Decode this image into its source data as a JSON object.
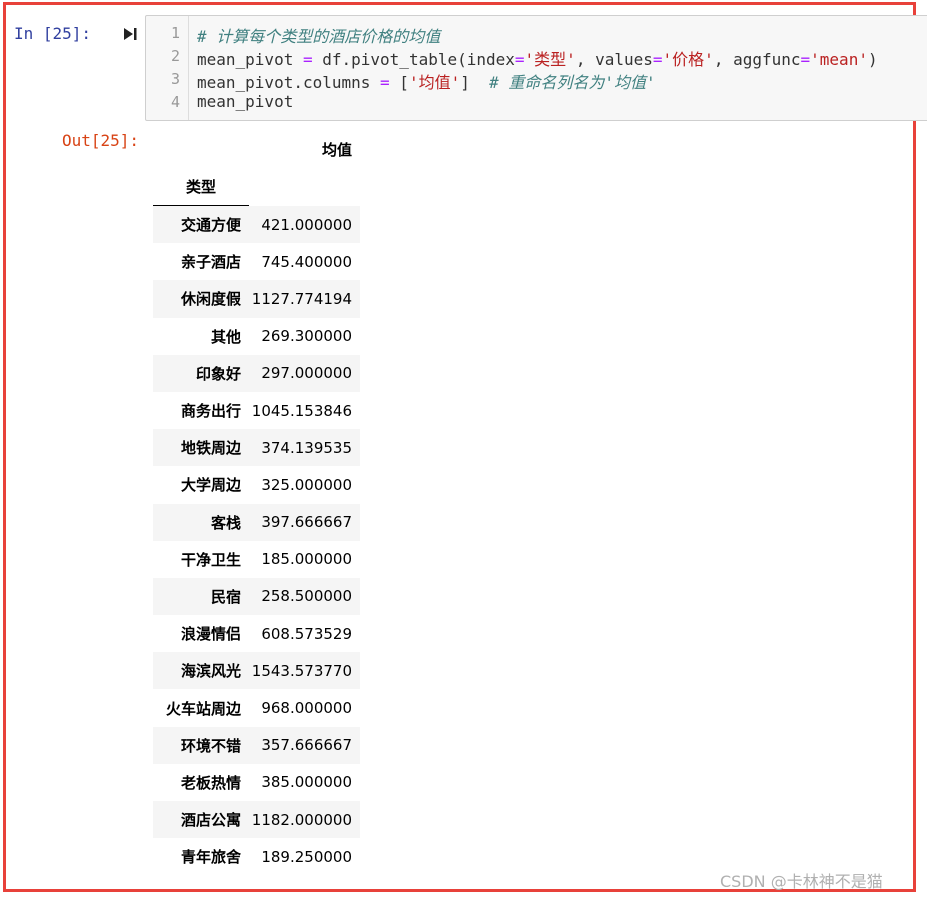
{
  "input_prompt": "In  [25]:",
  "output_prompt": "Out[25]:",
  "icons": {
    "run": "run-cell-icon"
  },
  "code": {
    "line_numbers": [
      "1",
      "2",
      "3",
      "4"
    ],
    "lines": [
      [
        {
          "text": "# 计算每个类型的酒店价格的均值",
          "kind": "comment"
        }
      ],
      [
        {
          "text": "mean_pivot ",
          "kind": "plain"
        },
        {
          "text": "=",
          "kind": "op"
        },
        {
          "text": " df.pivot_table(index",
          "kind": "plain"
        },
        {
          "text": "=",
          "kind": "op"
        },
        {
          "text": "'类型'",
          "kind": "string"
        },
        {
          "text": ", values",
          "kind": "plain"
        },
        {
          "text": "=",
          "kind": "op"
        },
        {
          "text": "'价格'",
          "kind": "string"
        },
        {
          "text": ", aggfunc",
          "kind": "plain"
        },
        {
          "text": "=",
          "kind": "op"
        },
        {
          "text": "'mean'",
          "kind": "string"
        },
        {
          "text": ")",
          "kind": "plain"
        }
      ],
      [
        {
          "text": "mean_pivot.columns ",
          "kind": "plain"
        },
        {
          "text": "=",
          "kind": "op"
        },
        {
          "text": " [",
          "kind": "plain"
        },
        {
          "text": "'均值'",
          "kind": "string"
        },
        {
          "text": "]  ",
          "kind": "plain"
        },
        {
          "text": "# 重命名列名为'均值'",
          "kind": "comment"
        }
      ],
      [
        {
          "text": "mean_pivot",
          "kind": "plain"
        }
      ]
    ]
  },
  "dataframe": {
    "column_header": "均值",
    "index_name": "类型",
    "rows": [
      {
        "index": "交通方便",
        "value": "421.000000"
      },
      {
        "index": "亲子酒店",
        "value": "745.400000"
      },
      {
        "index": "休闲度假",
        "value": "1127.774194"
      },
      {
        "index": "其他",
        "value": "269.300000"
      },
      {
        "index": "印象好",
        "value": "297.000000"
      },
      {
        "index": "商务出行",
        "value": "1045.153846"
      },
      {
        "index": "地铁周边",
        "value": "374.139535"
      },
      {
        "index": "大学周边",
        "value": "325.000000"
      },
      {
        "index": "客栈",
        "value": "397.666667"
      },
      {
        "index": "干净卫生",
        "value": "185.000000"
      },
      {
        "index": "民宿",
        "value": "258.500000"
      },
      {
        "index": "浪漫情侣",
        "value": "608.573529"
      },
      {
        "index": "海滨风光",
        "value": "1543.573770"
      },
      {
        "index": "火车站周边",
        "value": "968.000000"
      },
      {
        "index": "环境不错",
        "value": "357.666667"
      },
      {
        "index": "老板热情",
        "value": "385.000000"
      },
      {
        "index": "酒店公寓",
        "value": "1182.000000"
      },
      {
        "index": "青年旅舍",
        "value": "189.250000"
      }
    ]
  },
  "watermark": "CSDN @卡林神不是猫",
  "colors": {
    "frame_border": "#e8413a",
    "input_prompt": "#303f9f",
    "output_prompt": "#d84315",
    "comment": "#408080",
    "string": "#ba2121",
    "operator": "#aa22ff"
  }
}
